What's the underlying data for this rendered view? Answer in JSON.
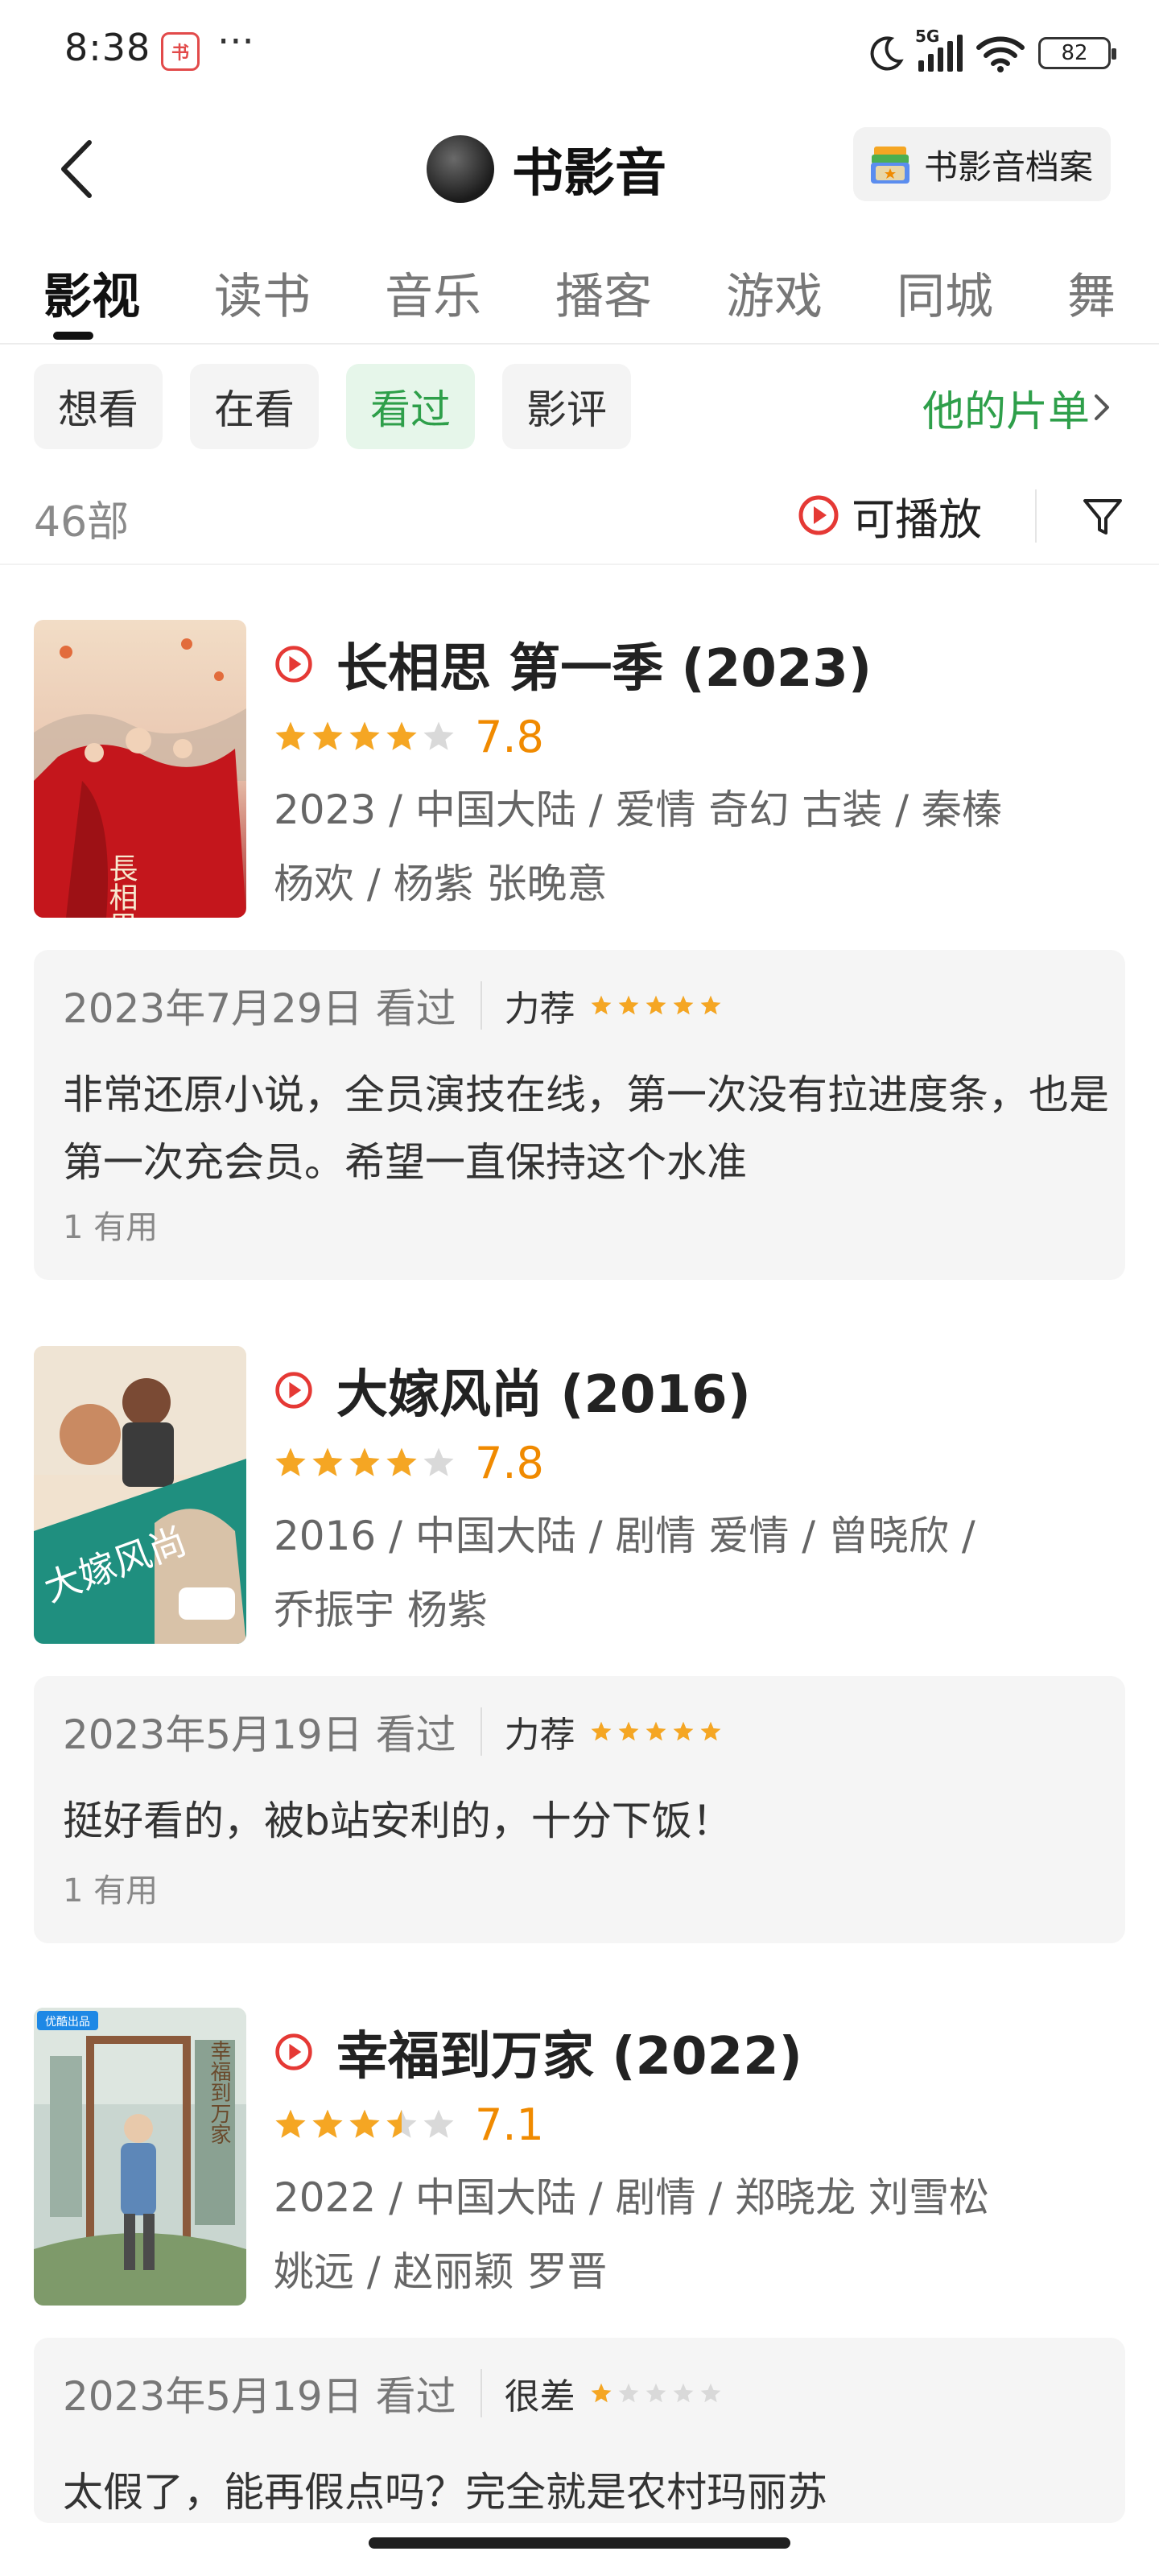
{
  "status_bar": {
    "time": "8:38",
    "app_badge": "书",
    "dots": "···",
    "network": "5G",
    "battery": "82"
  },
  "header": {
    "back_icon": "chevron-left-icon",
    "title": "书影音",
    "archive_label": "书影音档案"
  },
  "tabs": [
    {
      "label": "影视",
      "active": true
    },
    {
      "label": "读书"
    },
    {
      "label": "音乐"
    },
    {
      "label": "播客"
    },
    {
      "label": "游戏"
    },
    {
      "label": "同城"
    },
    {
      "label": "舞"
    }
  ],
  "filters": {
    "chips": [
      {
        "label": "想看"
      },
      {
        "label": "在看"
      },
      {
        "label": "看过",
        "active": true
      },
      {
        "label": "影评"
      }
    ],
    "list_link": "他的片单"
  },
  "summary": {
    "count": "46部",
    "playable_label": "可播放"
  },
  "colors": {
    "accent_green": "#2e9f4a",
    "star_orange": "#f5a623",
    "play_red": "#e53935"
  },
  "films": [
    {
      "title": "长相思 第一季 (2023)",
      "rating_stars": 4,
      "score": "7.8",
      "meta_line1": "2023 / 中国大陆 / 爱情 奇幻 古装 / 秦榛",
      "meta_line2": "杨欢 / 杨紫 张晚意",
      "poster_text": "長相思",
      "review": {
        "date": "2023年7月29日 看过",
        "verdict": "力荐",
        "stars": 5,
        "text": "非常还原小说，全员演技在线，第一次没有拉进度条，也是第一次充会员。希望一直保持这个水准",
        "useful": "1 有用"
      }
    },
    {
      "title": "大嫁风尚 (2016)",
      "rating_stars": 4,
      "score": "7.8",
      "meta_line1": "2016 / 中国大陆 / 剧情 爱情 / 曾晓欣 /",
      "meta_line2": "乔振宇 杨紫",
      "poster_text": "大嫁风尚",
      "review": {
        "date": "2023年5月19日 看过",
        "verdict": "力荐",
        "stars": 5,
        "text": "挺好看的，被b站安利的，十分下饭！",
        "useful": "1 有用"
      }
    },
    {
      "title": "幸福到万家 (2022)",
      "rating_stars": 3.5,
      "score": "7.1",
      "meta_line1": "2022 / 中国大陆 / 剧情 / 郑晓龙 刘雪松",
      "meta_line2": "姚远 / 赵丽颖 罗晋",
      "poster_text": "幸福到万家",
      "poster_badge": "优酷出品",
      "review": {
        "date": "2023年5月19日 看过",
        "verdict": "很差",
        "stars": 1,
        "text": "太假了，能再假点吗？完全就是农村玛丽苏",
        "useful": ""
      }
    }
  ]
}
